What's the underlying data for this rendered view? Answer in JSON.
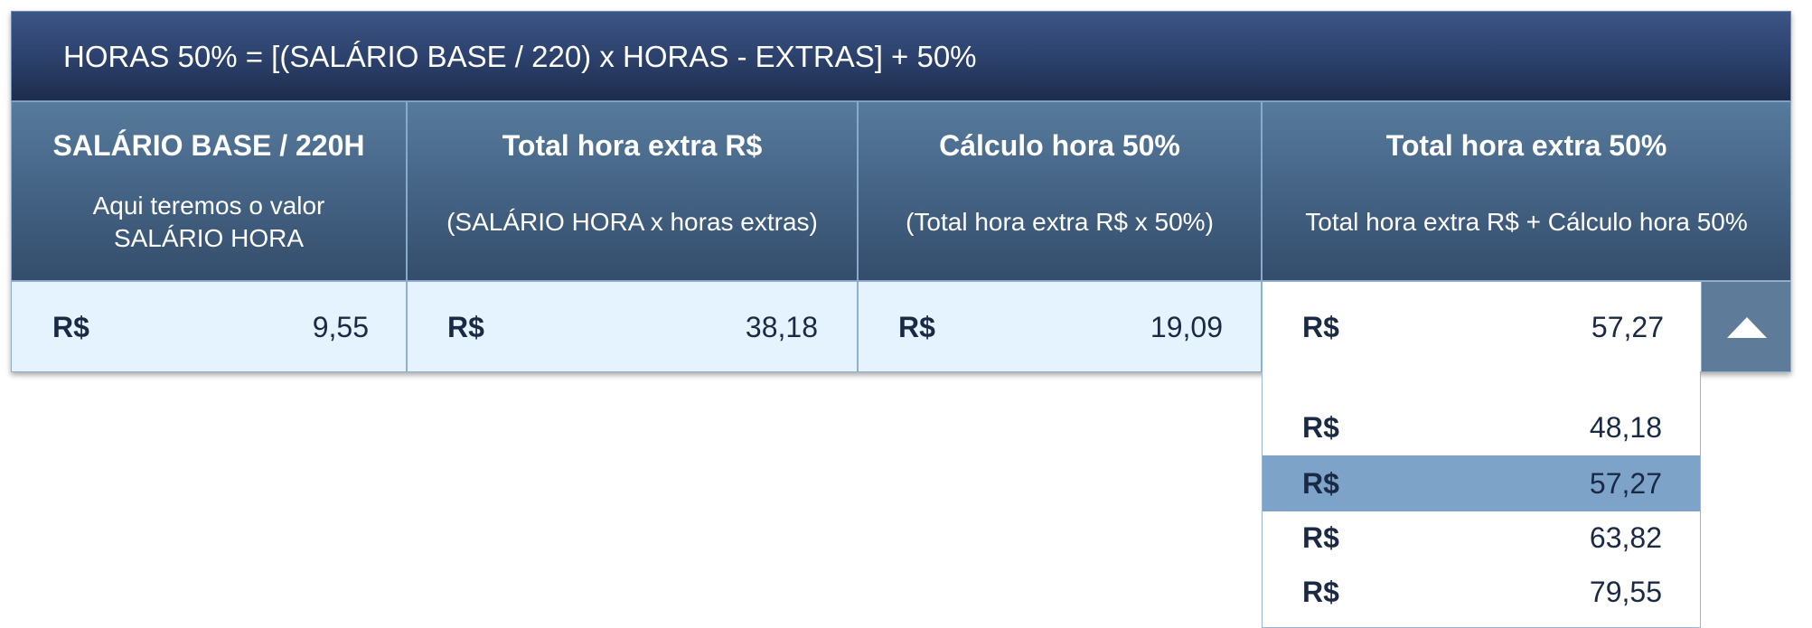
{
  "formula_title": "HORAS 50% = [(SALÁRIO BASE / 220) x HORAS - EXTRAS] + 50%",
  "columns": [
    {
      "title": "SALÁRIO BASE / 220H",
      "subtitle_line1": "Aqui teremos o valor",
      "subtitle_line2": "SALÁRIO HORA",
      "currency": "R$",
      "value": "9,55"
    },
    {
      "title": "Total hora extra R$",
      "subtitle": "(SALÁRIO HORA x horas extras)",
      "currency": "R$",
      "value": "38,18"
    },
    {
      "title": "Cálculo hora 50%",
      "subtitle": "(Total hora extra R$ x 50%)",
      "currency": "R$",
      "value": "19,09"
    },
    {
      "title": "Total hora extra 50%",
      "subtitle": "Total hora extra R$ + Cálculo hora 50%",
      "currency": "R$",
      "value": "57,27"
    }
  ],
  "dropdown": {
    "toggle_icon": "triangle-up-icon",
    "selected_index": 1,
    "selected_color": "#7ea3c9",
    "options": [
      {
        "currency": "R$",
        "value": "48,18"
      },
      {
        "currency": "R$",
        "value": "57,27"
      },
      {
        "currency": "R$",
        "value": "63,82"
      },
      {
        "currency": "R$",
        "value": "79,55"
      }
    ]
  },
  "colors": {
    "title_bar": "#2e4470",
    "header_cell": "#48688a",
    "value_cell": "#e4f3ff",
    "text_dark": "#1a2a44"
  }
}
